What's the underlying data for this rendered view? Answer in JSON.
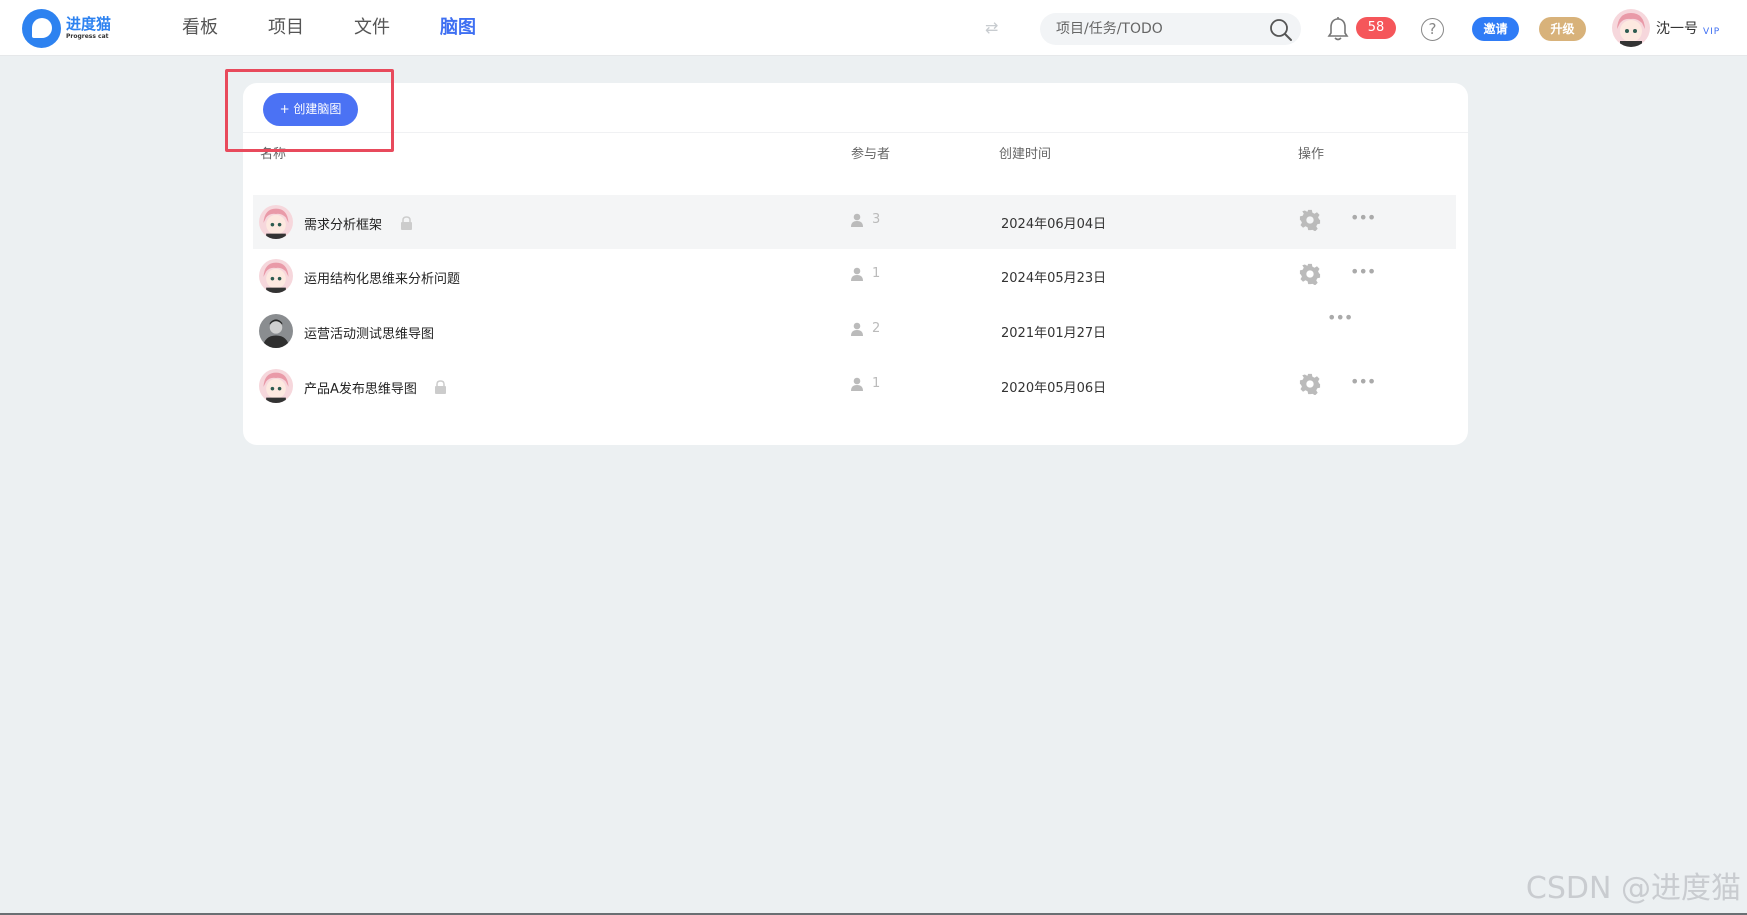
{
  "logo": {
    "name_cn": "进度猫",
    "name_en": "Progress cat"
  },
  "nav": [
    {
      "label": "看板",
      "active": false
    },
    {
      "label": "项目",
      "active": false
    },
    {
      "label": "文件",
      "active": false
    },
    {
      "label": "脑图",
      "active": true
    }
  ],
  "header": {
    "search_placeholder": "项目/任务/TODO",
    "notification_count": "58",
    "help_label": "?",
    "invite_label": "邀请",
    "upgrade_label": "升级",
    "username": "沈一号",
    "vip_label": "VIP"
  },
  "toolbar": {
    "create_label": "+ 创建脑图"
  },
  "table": {
    "headers": {
      "name": "名称",
      "participants": "参与者",
      "created": "创建时间",
      "actions": "操作"
    },
    "rows": [
      {
        "name": "需求分析框架",
        "participants": "3",
        "created": "2024年06月04日",
        "locked": true,
        "settings": true,
        "avatar": "pink"
      },
      {
        "name": "运用结构化思维来分析问题",
        "participants": "1",
        "created": "2024年05月23日",
        "locked": false,
        "settings": true,
        "avatar": "pink"
      },
      {
        "name": "运营活动测试思维导图",
        "participants": "2",
        "created": "2021年01月27日",
        "locked": false,
        "settings": false,
        "avatar": "gray"
      },
      {
        "name": "产品A发布思维导图",
        "participants": "1",
        "created": "2020年05月06日",
        "locked": true,
        "settings": true,
        "avatar": "pink"
      }
    ]
  },
  "watermark": "CSDN @进度猫",
  "colors": {
    "accent": "#4b72f4",
    "badge": "#f5565a",
    "upgrade": "#d8b27a",
    "highlight": "#e84a5c"
  }
}
